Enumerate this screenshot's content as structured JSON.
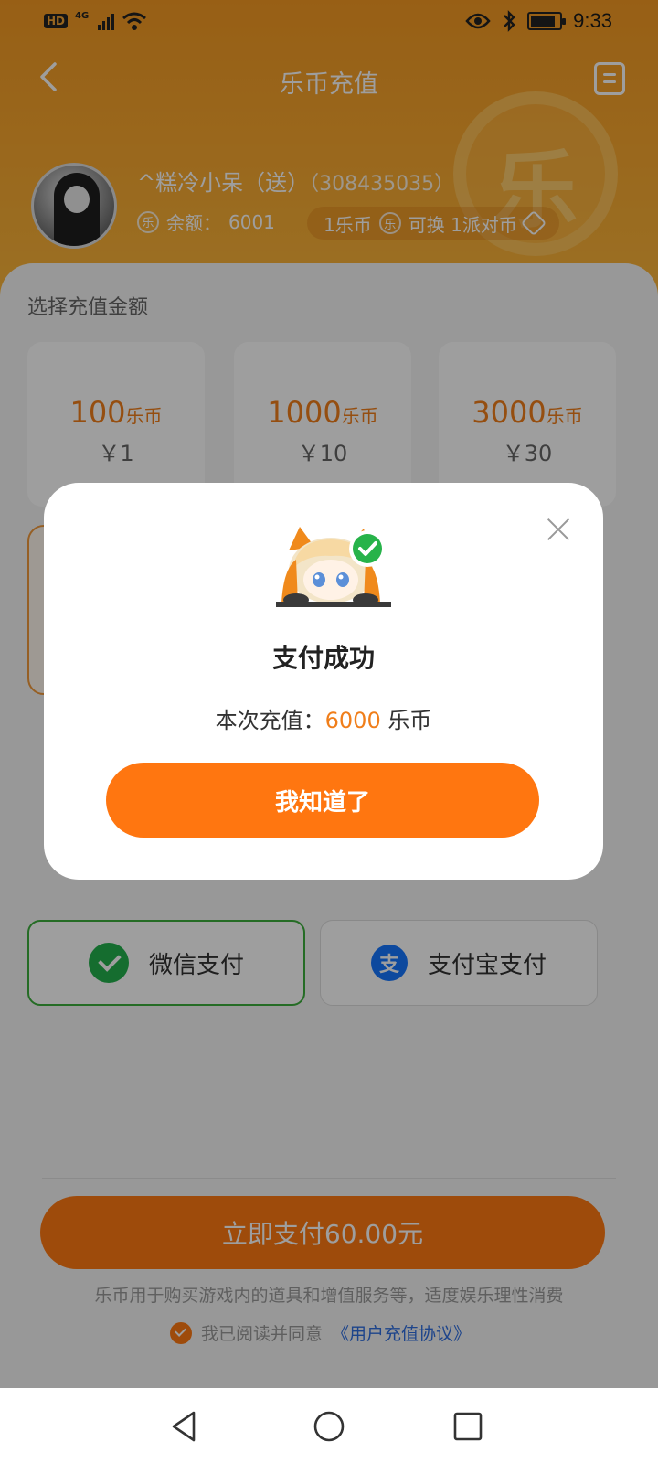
{
  "status_bar": {
    "hd_label": "HD",
    "net_label": "4G",
    "time": "9:33",
    "icons": [
      "signal-icon",
      "wifi-icon",
      "eye-icon",
      "bluetooth-icon",
      "battery-icon"
    ]
  },
  "nav": {
    "title": "乐币充值",
    "back_icon": "chevron-left-icon",
    "record_icon": "record-list-icon"
  },
  "user": {
    "name": "^糕冷小呆（送）",
    "uid": "（308435035）",
    "balance_label": "余额：",
    "balance_value": "6001",
    "coin_glyph": "乐",
    "rate_text_a": "1乐币",
    "rate_text_b": "可换 1派对币"
  },
  "recharge": {
    "section_label": "选择充值金额",
    "coin_unit": "乐币",
    "options": [
      {
        "coins": "100",
        "price": "￥1"
      },
      {
        "coins": "1000",
        "price": "￥10"
      },
      {
        "coins": "3000",
        "price": "￥30"
      }
    ]
  },
  "payment": {
    "wechat_label": "微信支付",
    "alipay_label": "支付宝支付",
    "alipay_glyph": "支",
    "pay_button": "立即支付60.00元",
    "footer_note": "乐币用于购买游戏内的道具和增值服务等，适度娱乐理性消费",
    "agree_prefix": "我已阅读并同意",
    "agree_link": "《用户充值协议》"
  },
  "modal": {
    "title": "支付成功",
    "msg_prefix": "本次充值：",
    "msg_amount": "6000",
    "msg_unit": " 乐币",
    "confirm_button": "我知道了",
    "close_icon": "close-icon"
  },
  "colors": {
    "brand_orange": "#ff7a12",
    "header_orange": "#f59a23",
    "amount_orange": "#f07e1a",
    "wechat_green": "#22b14c",
    "alipay_blue": "#1677ff",
    "link_blue": "#2f6fe0"
  }
}
